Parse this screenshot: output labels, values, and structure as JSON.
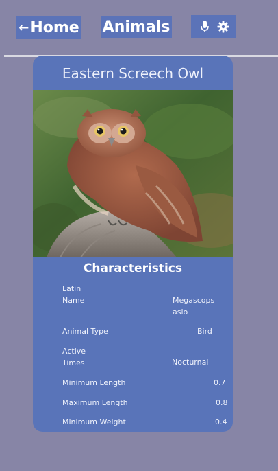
{
  "nav": {
    "home_arrow": "←",
    "home_label": "Home",
    "title": "Animals"
  },
  "toolbar": {
    "mic_icon": "microphone-icon",
    "settings_icon": "gear-icon"
  },
  "card": {
    "title": "Eastern Screech Owl",
    "image_alt": "Eastern screech owl perched on a branch",
    "section_title": "Characteristics",
    "rows": [
      {
        "label": "Latin Name",
        "value": "Megascops asio"
      },
      {
        "label": "Animal Type",
        "value": "Bird"
      },
      {
        "label": "Active Times",
        "value": "Nocturnal"
      },
      {
        "label": "Minimum Length",
        "value": "0.7"
      },
      {
        "label": "Maximum Length",
        "value": "0.8"
      },
      {
        "label": "Minimum Weight",
        "value": "0.4"
      }
    ]
  },
  "colors": {
    "background": "#8785a6",
    "accent": "#5b73b8",
    "card": "#5974b9"
  }
}
